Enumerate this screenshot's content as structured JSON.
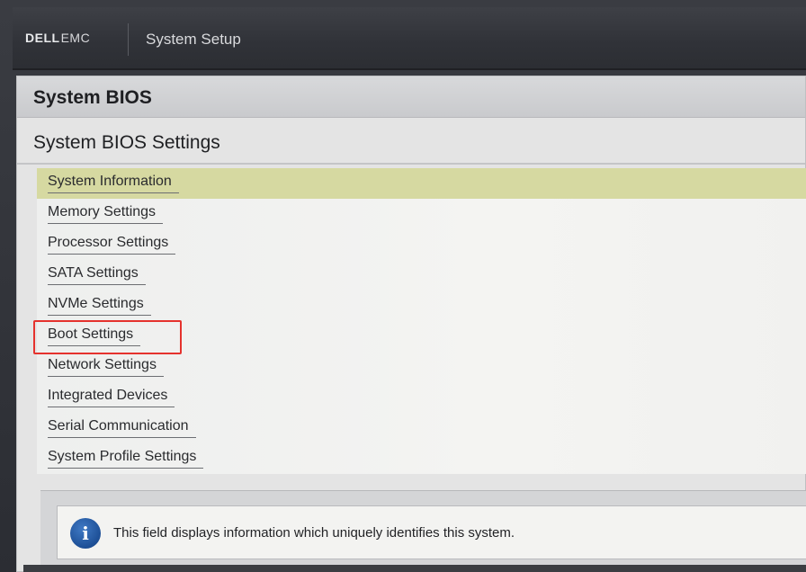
{
  "header": {
    "logo_dell": "DELL",
    "logo_emc": "EMC",
    "title": "System Setup"
  },
  "panel": {
    "title": "System BIOS",
    "section_title": "System BIOS Settings"
  },
  "menu": {
    "items": [
      {
        "label": "System Information",
        "selected": true
      },
      {
        "label": "Memory Settings"
      },
      {
        "label": "Processor Settings"
      },
      {
        "label": "SATA Settings"
      },
      {
        "label": "NVMe Settings"
      },
      {
        "label": "Boot Settings",
        "highlighted": true
      },
      {
        "label": "Network Settings"
      },
      {
        "label": "Integrated Devices"
      },
      {
        "label": "Serial Communication"
      },
      {
        "label": "System Profile Settings"
      }
    ]
  },
  "help": {
    "icon": "info-icon",
    "icon_glyph": "i",
    "text": "This field displays information which uniquely identifies this system."
  },
  "colors": {
    "selected_row": "#d6d9a1",
    "highlight_border": "#e5322d",
    "info_icon": "#1d4f96"
  }
}
